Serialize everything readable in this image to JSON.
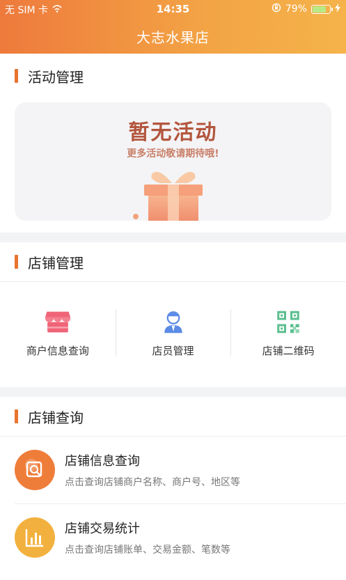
{
  "status_bar": {
    "carrier": "无 SIM 卡",
    "time": "14:35",
    "battery": "79%",
    "battery_level": 0.79
  },
  "header": {
    "title": "大志水果店"
  },
  "activity": {
    "title": "活动管理",
    "empty_title": "暂无活动",
    "empty_subtitle": "更多活动敬请期待哦!"
  },
  "store_manage": {
    "title": "店铺管理",
    "items": [
      {
        "label": "商户信息查询",
        "icon": "shop-icon"
      },
      {
        "label": "店员管理",
        "icon": "staff-icon"
      },
      {
        "label": "店铺二维码",
        "icon": "qrcode-icon"
      }
    ]
  },
  "store_query": {
    "title": "店铺查询",
    "items": [
      {
        "title": "店铺信息查询",
        "desc": "点击查询店铺商户名称、商户号、地区等",
        "icon": "search-info-icon",
        "color": "#ef7d3a"
      },
      {
        "title": "店铺交易统计",
        "desc": "点击查询店铺账单、交易金额、笔数等",
        "icon": "bar-chart-icon",
        "color": "#f2b13f"
      }
    ]
  },
  "colors": {
    "accent": "#e8742f",
    "header_start": "#ee7a3c",
    "header_end": "#f5b34a"
  }
}
